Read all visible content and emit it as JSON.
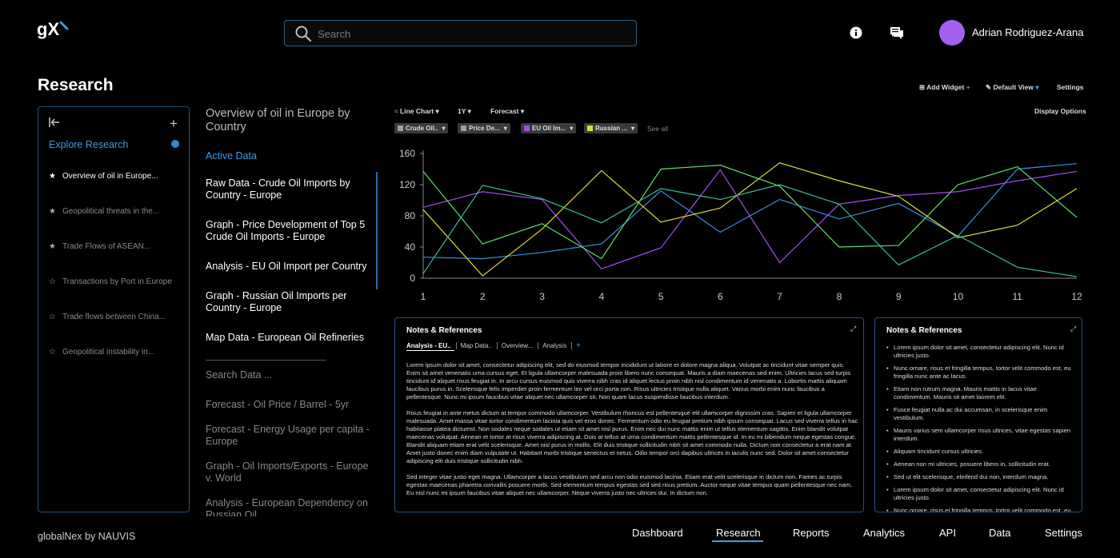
{
  "header": {
    "logo_text": "gX",
    "search_placeholder": "Search",
    "user_name": "Adrian Rodriguez-Arana",
    "colors": {
      "accent": "#3d9be9",
      "avatar": "#a45ef0",
      "border": "#25507a"
    }
  },
  "page": {
    "title": "Research"
  },
  "sidebar": {
    "explore_label": "Explore Research",
    "items": [
      {
        "label": "Overview of oil in Europe...",
        "starred": true,
        "active": true
      },
      {
        "label": "Geopolitical threats in the...",
        "starred": true,
        "active": false
      },
      {
        "label": "Trade Flows of ASEAN...",
        "starred": true,
        "active": false
      },
      {
        "label": "Transactions by Port in Europe",
        "starred": false,
        "active": false
      },
      {
        "label": "Trade flows between China...",
        "starred": false,
        "active": false
      },
      {
        "label": "Geopolitical instability in...",
        "starred": false,
        "active": false
      }
    ]
  },
  "middle": {
    "title": "Overview of oil in Europe by Country",
    "active_label": "Active Data",
    "active_items": [
      "Raw Data - Crude Oil Imports by Country - Europe",
      "Graph - Price Development of Top 5 Crude Oil Imports - Europe",
      "Analysis - EU Oil Import per Country",
      "Graph - Russian Oil Imports per Country - Europe",
      "Map Data - European Oil Refineries"
    ],
    "search_placeholder": "Search Data ...",
    "suggestions": [
      "Forecast - Oil Price / Barrel - 5yr",
      "Forecast - Energy Usage per capita - Europe",
      "Graph - Oil Imports/Exports - Europe v. World",
      "Analysis - European Dependency on Russian Oil"
    ]
  },
  "toolbar": {
    "add_widget": "Add Widget",
    "default_view": "Default View",
    "settings": "Settings",
    "chart_type": "Line Chart",
    "range": "1Y",
    "forecast": "Forecast",
    "display_options": "Display Options",
    "see_all": "See all",
    "pills": [
      {
        "label": "Crude Oil..",
        "color": "#9aa0a6"
      },
      {
        "label": "Price De...",
        "color": "#9aa0a6"
      },
      {
        "label": "EU Oil Im...",
        "color": "#a24ef0"
      },
      {
        "label": "Russian ...",
        "color": "#d8dd3a"
      }
    ]
  },
  "chart_data": {
    "type": "line",
    "x": [
      1,
      2,
      3,
      4,
      5,
      6,
      7,
      8,
      9,
      10,
      11,
      12
    ],
    "ylim": [
      0,
      160
    ],
    "yticks": [
      0,
      40,
      80,
      120,
      160
    ],
    "grid": false,
    "series": [
      {
        "color": "#3f8fe0",
        "values": [
          27,
          25,
          33,
          44,
          112,
          59,
          101,
          76,
          96,
          54,
          140,
          147
        ]
      },
      {
        "color": "#a24ef0",
        "values": [
          91,
          111,
          101,
          12,
          39,
          139,
          20,
          95,
          106,
          111,
          125,
          137
        ]
      },
      {
        "color": "#5fe06a",
        "values": [
          137,
          44,
          70,
          25,
          140,
          145,
          118,
          40,
          42,
          120,
          143,
          78
        ]
      },
      {
        "color": "#d8dd3a",
        "values": [
          88,
          3,
          63,
          138,
          72,
          90,
          148,
          125,
          105,
          52,
          68,
          115
        ]
      },
      {
        "color": "#3fbf9a",
        "values": [
          6,
          119,
          102,
          71,
          115,
          101,
          120,
          95,
          17,
          55,
          14,
          2
        ]
      }
    ]
  },
  "notes_main": {
    "title": "Notes & References",
    "tabs": [
      "Analysis - EU..",
      "Map Data..",
      "Overview...",
      "Analysis",
      "+"
    ],
    "paragraphs": [
      "Lorem ipsum dolor sit amet, consectetur adipiscing elit, sed do eiusmod tempor incididunt ut labore et dolore magna aliqua. Volutpat ac tincidunt vitae semper quis. Enim sit amet venenatis urna cursus eget. Et ligula ullamcorper malesuada proin libero nunc consequat. Mauris a diam maecenas sed enim. Ultricies lacus sed turpis tincidunt id aliquet risus feugiat in. In arcu cursus euismod quis viverra nibh cras id aliquet lectus proin nibh nisl condimentum id venenatis a. Lobortis mattis aliquam faucibus purus in. Scelerisque felis imperdiet proin fermentum leo vel orci porta non. Risus ultricies tristique nulla aliquet. Varius morbi enim nunc faucibus a pellentesque. Nunc mi ipsum faucibus vitae aliquet nec ullamcorper sit. Non quam lacus suspendisse faucibus interdum.",
      "Risus feugiat in ante metus dictum at tempor commodo ullamcorper. Vestibulum rhoncus est pellentesque elit ullamcorper dignissim cras. Sapien et ligula ullamcorper malesuada. Amet massa vitae tortor condimentum lacinia quis vel eros donec. Fermentum odio eu feugiat pretium nibh ipsum consequat. Lacus sed viverra tellus in hac habitasse platea dictumst. Non sodales neque sodales ut etiam sit amet nisl purus. Enim nec dui nunc mattis enim ut tellus elementum sagittis. Enim blandit volutpat maecenas volutpat. Aenean et tortor at risus viverra adipiscing at. Duis at tellus at urna condimentum mattis pellentesque id. In eu mi bibendum neque egestas congue. Blandit aliquam etiam erat velit scelerisque. Amet nisl purus in mollis. Elit duis tristique sollicitudin nibh sit amet commodo nulla. Dictum non consectetur a erat nam at. Amet justo donec enim diam vulputate ut. Habitant morbi tristique senectus et netus. Odio tempor orci dapibus ultrices in iaculis nunc sed. Dolor sit amet consectetur adipiscing elit duis tristique sollicitudin nibh.",
      "Sed integer vitae justo eget magna. Ullamcorper a lacus vestibulum sed arcu non odio euismod lacinia. Etiam erat velit scelerisque in dictum non. Fames ac turpis egestas maecenas pharetra convallis posuere morbi. Sed elementum tempus egestas sed sed risus pretium. Auctor neque vitae tempus quam pellentesque nec nam. Eu nisl nunc mi ipsum faucibus vitae aliquet nec ullamcorper. Neque viverra justo nec ultrices dui. In dictum non."
    ]
  },
  "notes_side": {
    "title": "Notes & References",
    "bullets": [
      "Lorem ipsum dolor sit amet, consectetur adipiscing elit. Nunc id ultricies justo.",
      "Nunc ornare, risus et fringilla tempus, tortor velit commodo est, eu fringilla nunc ante ac lacus.",
      "Etiam non rutrum magna. Mauris mattis in lacus vitae condimentum. Mauris sit amet laoreet elit.",
      "Fusce feugiat nulla ac dui accumsan, in scelerisque enim vestibulum.",
      "Mauris varius sem ullamcorper risus ultrices, vitae egestas sapien interdum.",
      "Aliquam tincidunt cursus ultricies.",
      "Aenean non mi ultricies, posuere libero in, sollicitudin erat.",
      "Sed ut elit scelerisque, eleifend dui non, interdum magna.",
      "Lorem ipsum dolor sit amet, consectetur adipiscing elit. Nunc id ultricies justo.",
      "Nunc ornare, risus et fringilla tempus, tortor velit commodo est, eu fringilla nunc ante ac lacus."
    ]
  },
  "footer": {
    "brand": "globalNex by NAUVIS",
    "nav": [
      "Dashboard",
      "Research",
      "Reports",
      "Analytics",
      "API",
      "Data",
      "Settings"
    ],
    "active": "Research"
  }
}
